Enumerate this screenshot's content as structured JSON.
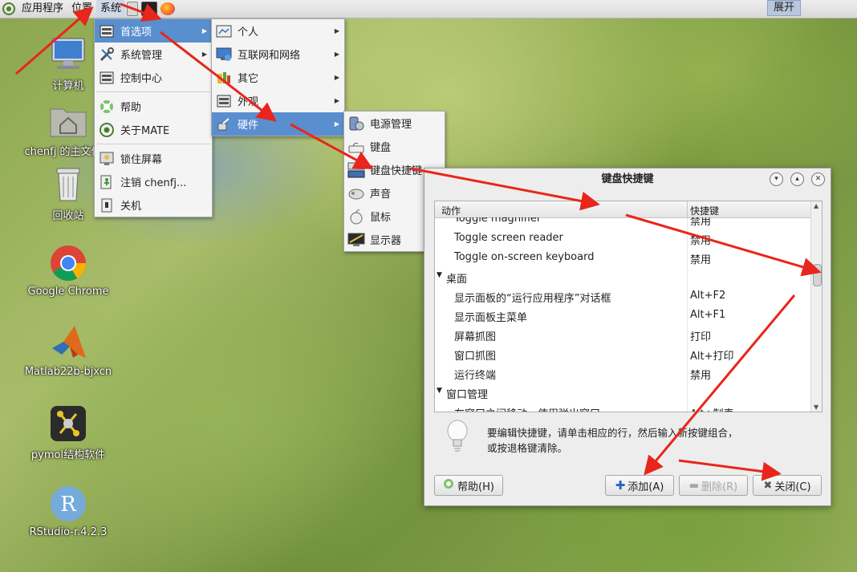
{
  "top_panel": {
    "menus": [
      "应用程序",
      "位置",
      "系统"
    ],
    "expand_label": "展开"
  },
  "desktop_icons": [
    {
      "label": "计算机",
      "icon": "computer-icon"
    },
    {
      "label": "chenfj 的主文件夹",
      "icon": "home-folder-icon"
    },
    {
      "label": "回收站",
      "icon": "trash-icon"
    },
    {
      "label": "Google Chrome",
      "icon": "chrome-icon"
    },
    {
      "label": "Matlab22b-bjxcn",
      "icon": "matlab-icon"
    },
    {
      "label": "pymol结构软件",
      "icon": "pymol-icon"
    },
    {
      "label": "RStudio-r.4.2.3",
      "icon": "rstudio-icon"
    }
  ],
  "system_menu": {
    "items": [
      {
        "label": "首选项",
        "icon": "preferences-icon",
        "submenu": true,
        "selected": true
      },
      {
        "label": "系统管理",
        "icon": "tools-icon",
        "submenu": true
      },
      {
        "label": "控制中心",
        "icon": "control-center-icon",
        "submenu": false
      },
      {
        "label": "帮助",
        "icon": "help-icon",
        "submenu": false
      },
      {
        "label": "关于MATE",
        "icon": "mate-logo-icon",
        "submenu": false
      },
      {
        "label": "锁住屏幕",
        "icon": "lock-screen-icon",
        "submenu": false
      },
      {
        "label": "注销 chenfj...",
        "icon": "logout-icon",
        "submenu": false
      },
      {
        "label": "关机",
        "icon": "shutdown-icon",
        "submenu": false
      }
    ]
  },
  "preferences_menu": {
    "items": [
      {
        "label": "个人",
        "icon": "personal-icon",
        "selected": false
      },
      {
        "label": "互联网和网络",
        "icon": "network-icon",
        "selected": false
      },
      {
        "label": "其它",
        "icon": "other-icon",
        "selected": false
      },
      {
        "label": "外观",
        "icon": "appearance-icon",
        "selected": false
      },
      {
        "label": "硬件",
        "icon": "hardware-icon",
        "selected": true
      }
    ]
  },
  "hardware_menu": {
    "items": [
      {
        "label": "电源管理",
        "icon": "power-icon"
      },
      {
        "label": "键盘",
        "icon": "keyboard-icon"
      },
      {
        "label": "键盘快捷键",
        "icon": "keyboard-shortcuts-icon"
      },
      {
        "label": "声音",
        "icon": "sound-icon"
      },
      {
        "label": "鼠标",
        "icon": "mouse-icon"
      },
      {
        "label": "显示器",
        "icon": "monitor-icon"
      }
    ]
  },
  "dialog": {
    "title": "键盘快捷键",
    "columns": {
      "action": "动作",
      "shortcut": "快捷键"
    },
    "rows": [
      {
        "type": "item",
        "action": "Toggle magnifier",
        "shortcut": "禁用"
      },
      {
        "type": "item",
        "action": "Toggle screen reader",
        "shortcut": "禁用"
      },
      {
        "type": "item",
        "action": "Toggle on-screen keyboard",
        "shortcut": "禁用"
      },
      {
        "type": "category",
        "action": "桌面",
        "shortcut": ""
      },
      {
        "type": "item",
        "action": "显示面板的“运行应用程序”对话框",
        "shortcut": "Alt+F2"
      },
      {
        "type": "item",
        "action": "显示面板主菜单",
        "shortcut": "Alt+F1"
      },
      {
        "type": "item",
        "action": "屏幕抓图",
        "shortcut": "打印"
      },
      {
        "type": "item",
        "action": "窗口抓图",
        "shortcut": "Alt+打印"
      },
      {
        "type": "item",
        "action": "运行终端",
        "shortcut": "禁用"
      },
      {
        "type": "category",
        "action": "窗口管理",
        "shortcut": ""
      },
      {
        "type": "item",
        "action": "在窗口之间移动，使用弹出窗口",
        "shortcut": "Alt+制表"
      }
    ],
    "hint": "要编辑快捷键，请单击相应的行，然后输入新按键组合，或按退格键清除。",
    "buttons": {
      "help": "帮助(H)",
      "add": "添加(A)",
      "remove": "删除(R)",
      "close": "关闭(C)"
    }
  },
  "colors": {
    "menu_highlight": "#5a8fcf",
    "annotation_arrow": "#e8261c"
  }
}
